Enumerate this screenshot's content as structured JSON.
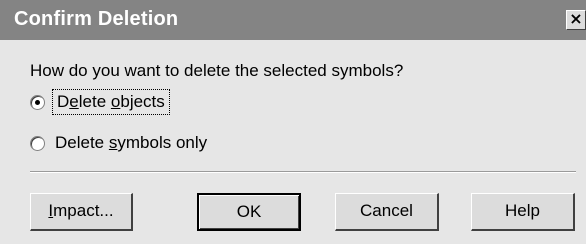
{
  "window": {
    "title": "Confirm Deletion",
    "close_glyph": "×"
  },
  "dialog": {
    "question": "How do you want to delete the selected symbols?",
    "options": [
      {
        "label_pre": "D",
        "label_accel": "e",
        "label_post": "lete ",
        "label_accel2": "o",
        "label_post2": "bjects",
        "selected": true
      },
      {
        "label_pre": "Delete ",
        "label_accel": "s",
        "label_post": "ymbols only",
        "selected": false
      }
    ]
  },
  "buttons": {
    "impact_accel": "I",
    "impact_rest": "mpact...",
    "ok": "OK",
    "cancel": "Cancel",
    "help": "Help"
  },
  "colors": {
    "titlebar": "#848484",
    "body": "#e6e6e6"
  }
}
